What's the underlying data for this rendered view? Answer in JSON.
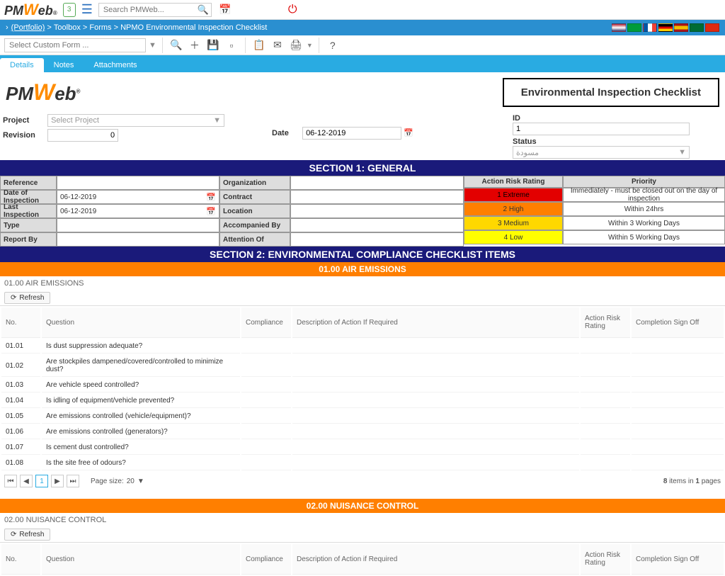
{
  "top": {
    "search_placeholder": "Search PMWeb...",
    "shield_badge": "3"
  },
  "breadcrumb": {
    "portfolio": "(Portfolio)",
    "toolbox": "Toolbox",
    "forms": "Forms",
    "page": "NPMO Environmental Inspection Checklist"
  },
  "toolbar": {
    "custom_form_placeholder": "Select Custom Form ..."
  },
  "tabs": {
    "details": "Details",
    "notes": "Notes",
    "attachments": "Attachments"
  },
  "title_box": "Environmental Inspection Checklist",
  "form": {
    "project_lbl": "Project",
    "project_placeholder": "Select Project",
    "revision_lbl": "Revision",
    "revision_val": "0",
    "date_lbl": "Date",
    "date_val": "06-12-2019",
    "id_lbl": "ID",
    "id_val": "1",
    "status_lbl": "Status",
    "status_val": "مسودة"
  },
  "section1_hdr": "SECTION 1: GENERAL",
  "gen_left": {
    "reference_lbl": "Reference",
    "reference_val": "",
    "doi_lbl": "Date of Inspection",
    "doi_val": "06-12-2019",
    "last_lbl": "Last Inspection",
    "last_val": "06-12-2019",
    "type_lbl": "Type",
    "type_val": "",
    "report_lbl": "Report By",
    "report_val": ""
  },
  "gen_mid": {
    "org_lbl": "Organization",
    "contract_lbl": "Contract",
    "loc_lbl": "Location",
    "acc_lbl": "Accompanied By",
    "att_lbl": "Attention Of"
  },
  "risk": {
    "hdr1": "Action Risk Rating",
    "hdr2": "Priority",
    "r1": "1 Extreme",
    "p1": "Immediately - must be closed out on the day of inspection",
    "r2": "2 High",
    "p2": "Within 24hrs",
    "r3": "3 Medium",
    "p3": "Within 3 Working Days",
    "r4": "4 Low",
    "p4": "Within 5 Working Days"
  },
  "section2_hdr": "SECTION 2: ENVIRONMENTAL COMPLIANCE CHECKLIST ITEMS",
  "sub1_hdr": "01.00 AIR EMISSIONS",
  "sub1_title": "01.00 AIR EMISSIONS",
  "refresh": "Refresh",
  "cols": {
    "no": "No.",
    "q": "Question",
    "comp": "Compliance",
    "desc": "Description of Action If Required",
    "arr": "Action Risk Rating",
    "sign": "Completion Sign Off"
  },
  "rows1": [
    {
      "no": "01.01",
      "q": "Is dust suppression adequate?"
    },
    {
      "no": "01.02",
      "q": "Are stockpiles dampened/covered/controlled to minimize dust?"
    },
    {
      "no": "01.03",
      "q": "Are vehicle speed controlled?"
    },
    {
      "no": "01.04",
      "q": "Is idling of equipment/vehicle prevented?"
    },
    {
      "no": "01.05",
      "q": "Are emissions controlled (vehicle/equipment)?"
    },
    {
      "no": "01.06",
      "q": "Are emissions controlled (generators)?"
    },
    {
      "no": "01.07",
      "q": "Is cement dust controlled?"
    },
    {
      "no": "01.08",
      "q": "Is the site free of odours?"
    }
  ],
  "pager": {
    "page": "1",
    "size_lbl": "Page size:",
    "size": "20",
    "info_a": "8",
    "info_b": "items in",
    "info_c": "1",
    "info_d": "pages"
  },
  "sub2_hdr": "02.00 NUISANCE CONTROL",
  "sub2_title": "02.00 NUISANCE CONTROL",
  "cols2": {
    "desc": "Description of Action if Required"
  }
}
